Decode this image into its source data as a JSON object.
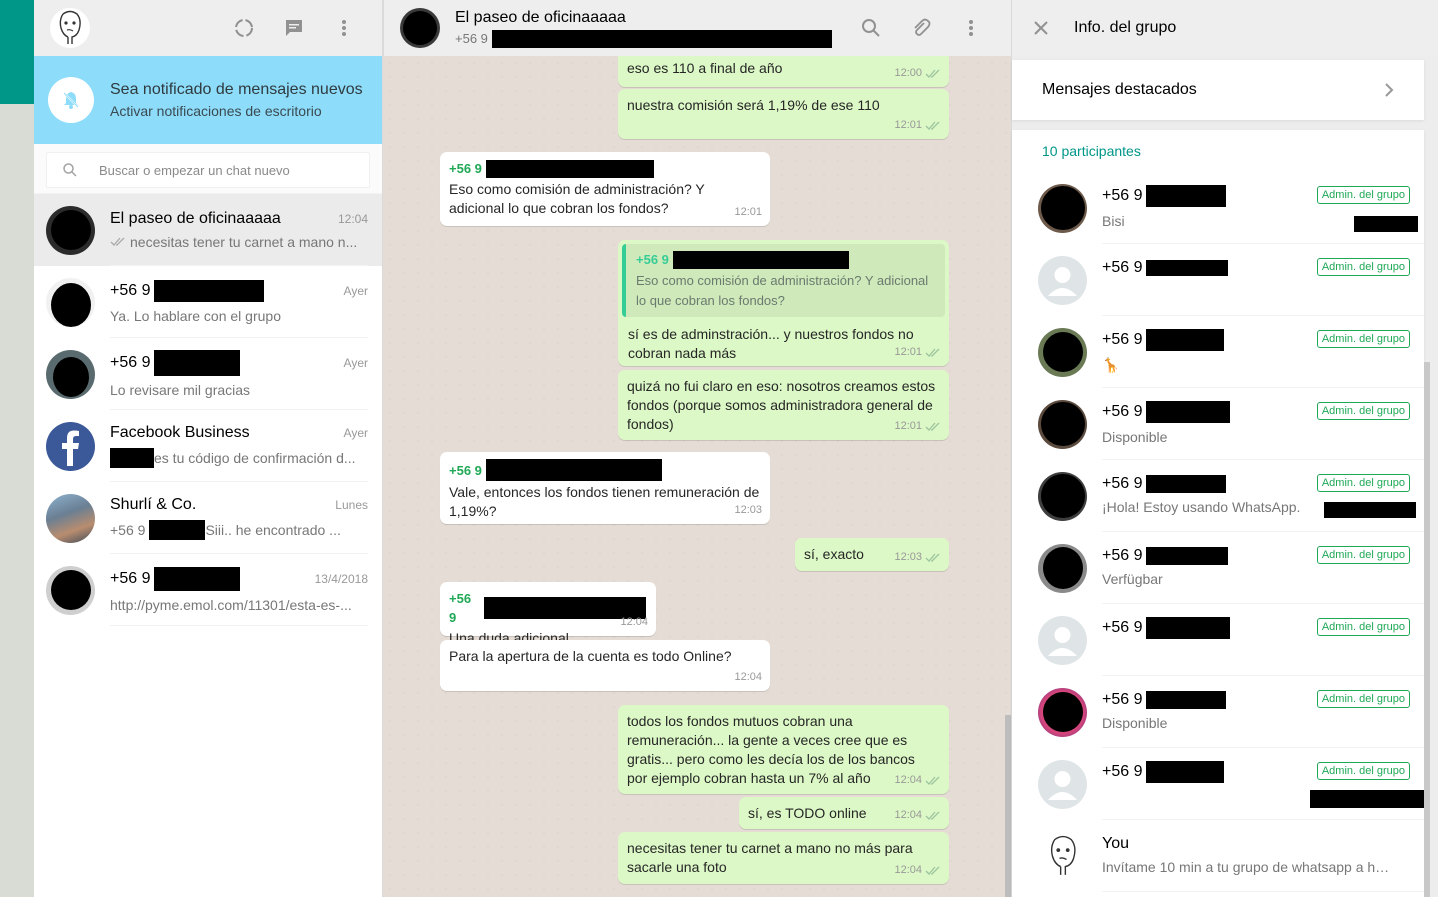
{
  "left": {
    "notification": {
      "title": "Sea notificado de mensajes nuevos",
      "subtitle": "Activar notificaciones de escritorio"
    },
    "search_placeholder": "Buscar o empezar un chat nuevo",
    "chats": [
      {
        "name": "El paseo de oficinaaaaa",
        "time": "12:04",
        "preview": "necesitas tener tu carnet a mano n..."
      },
      {
        "name": "+56 9",
        "time": "Ayer",
        "preview": "Ya. Lo hablare con el grupo"
      },
      {
        "name": "+56 9",
        "time": "Ayer",
        "preview": "Lo revisare mil gracias"
      },
      {
        "name": "Facebook Business",
        "time": "Ayer",
        "preview": "es tu código de confirmación d..."
      },
      {
        "name": "Shurlí & Co.",
        "time": "Lunes",
        "preview_prefix": "+56 9",
        "preview": "Siii.. he encontrado ..."
      },
      {
        "name": "+56 9",
        "time": "13/4/2018",
        "preview": "http://pyme.emol.com/11301/esta-es-..."
      }
    ]
  },
  "center": {
    "title": "El paseo de oficinaaaaa",
    "subtitle": "+56 9",
    "messages": [
      {
        "text": "eso es 110 a final de año",
        "time": "12:00"
      },
      {
        "text": "nuestra comisión será 1,19% de ese 110",
        "time": "12:01"
      },
      {
        "sender": "+56 9",
        "text": "Eso como comisión de administración? Y adicional lo que cobran los fondos?",
        "time": "12:01"
      },
      {
        "quote_sender": "+56 9",
        "quote_text": "Eso como comisión de administración? Y adicional lo que cobran los fondos?",
        "text": "sí es de adminstración... y nuestros fondos no cobran nada más",
        "time": "12:01"
      },
      {
        "text": "quizá no fui claro en eso: nosotros creamos estos fondos (porque somos administradora general de fondos)",
        "time": "12:01"
      },
      {
        "sender": "+56 9",
        "text": "Vale, entonces los fondos tienen remuneración de 1,19%?",
        "time": "12:03"
      },
      {
        "text": "sí, exacto",
        "time": "12:03"
      },
      {
        "sender": "+56 9",
        "text": "Una duda adicional",
        "time": "12:04"
      },
      {
        "text": "Para la apertura de la cuenta es todo Online?",
        "time": "12:04"
      },
      {
        "text": "todos los fondos mutuos cobran una remuneración... la gente a veces cree que es gratis... pero como les decía los de los bancos por ejemplo cobran hasta un 7% al año",
        "time": "12:04"
      },
      {
        "text": "sí, es TODO online",
        "time": "12:04"
      },
      {
        "text": "necesitas tener tu carnet a mano no más para sacarle una foto",
        "time": "12:04"
      }
    ]
  },
  "right": {
    "title": "Info. del grupo",
    "starred": "Mensajes destacados",
    "participants_count": "10 participantes",
    "admin_label": "Admin. del grupo",
    "participants": [
      {
        "num": "+56 9",
        "status": "Bisi"
      },
      {
        "num": "+56 9",
        "status": ""
      },
      {
        "num": "+56 9",
        "status": "🦒"
      },
      {
        "num": "+56 9",
        "status": "Disponible"
      },
      {
        "num": "+56 9",
        "status": "¡Hola! Estoy usando WhatsApp."
      },
      {
        "num": "+56 9",
        "status": "Verfügbar"
      },
      {
        "num": "+56 9",
        "status": ""
      },
      {
        "num": "+56 9",
        "status": "Disponible"
      },
      {
        "num": "+56 9",
        "status": ""
      },
      {
        "num": "You",
        "status": "Invítame 10 min a tu grupo de whatsapp a habl..."
      }
    ]
  },
  "colors": {
    "teal": "#009688",
    "outgoing_bubble": "#dcf8c6",
    "notify_banner": "#8ddcf9",
    "sender_green": "#1fa855"
  }
}
